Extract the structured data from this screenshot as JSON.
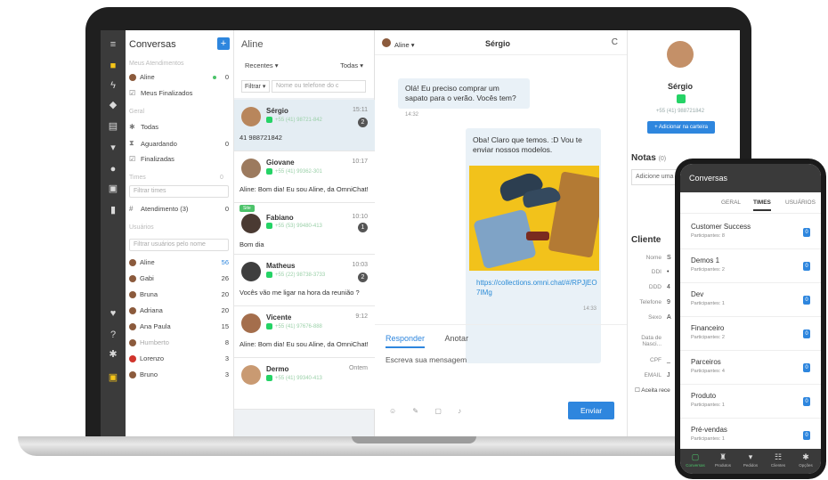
{
  "rail": {
    "icons": [
      "menu-icon",
      "chat-icon",
      "bolt-icon",
      "tag-icon",
      "list-icon",
      "cart-icon",
      "user-icon",
      "contacts-icon",
      "chart-icon",
      "heart-icon",
      "help-icon",
      "gear-icon",
      "info-icon"
    ]
  },
  "sidebar": {
    "title": "Conversas",
    "add": "+",
    "section_meus": "Meus Atendimentos",
    "meus": [
      {
        "label": "Aline",
        "count": "0"
      },
      {
        "label": "Meus Finalizados",
        "count": ""
      }
    ],
    "section_geral": "Geral",
    "geral": [
      {
        "label": "Todas",
        "count": ""
      },
      {
        "label": "Aguardando",
        "count": "0"
      },
      {
        "label": "Finalizadas",
        "count": ""
      }
    ],
    "section_times": "Times",
    "times_count": "0",
    "times_filter": "Filtrar times",
    "times": [
      {
        "label": "Atendimento (3)",
        "count": "0"
      }
    ],
    "section_usuarios": "Usuários",
    "users_filter": "Filtrar usuários pelo nome",
    "users": [
      {
        "label": "Aline",
        "count": "56"
      },
      {
        "label": "Gabi",
        "count": "26"
      },
      {
        "label": "Bruna",
        "count": "20"
      },
      {
        "label": "Adriana",
        "count": "20"
      },
      {
        "label": "Ana Paula",
        "count": "15"
      },
      {
        "label": "Humberto",
        "count": "8"
      },
      {
        "label": "Lorenzo",
        "count": "3"
      },
      {
        "label": "Bruno",
        "count": "3"
      }
    ]
  },
  "chats": {
    "title": "Aline",
    "recentes": "Recentes ▾",
    "todas": "Todas ▾",
    "filtrar": "Filtrar ▾",
    "search_placeholder": "Nome ou telefone do c",
    "items": [
      {
        "name": "Sérgio",
        "phone": "+55 (41) 98721-842",
        "time": "15:11",
        "badge": "2",
        "preview": "41 988721842",
        "tag": ""
      },
      {
        "name": "Giovane",
        "phone": "+55 (41) 99362-301",
        "time": "10:17",
        "badge": "",
        "preview": "Aline: Bom dia! Eu sou Aline, da OmniChat!",
        "tag": ""
      },
      {
        "name": "Fabiano",
        "phone": "+55 (53) 99480-413",
        "time": "10:10",
        "badge": "1",
        "preview": "Bom dia",
        "tag": "Site"
      },
      {
        "name": "Matheus",
        "phone": "+55 (22) 98738-3733",
        "time": "10:03",
        "badge": "2",
        "preview": "Vocês vão me ligar na hora da reunião ?",
        "tag": ""
      },
      {
        "name": "Vicente",
        "phone": "+55 (41) 97676-888",
        "time": "9:12",
        "badge": "",
        "preview": "Aline: Bom dia! Eu sou Aline, da OmniChat!",
        "tag": ""
      },
      {
        "name": "Dermo",
        "phone": "+55 (41) 99340-413",
        "time": "Ontem",
        "badge": "",
        "preview": "",
        "tag": ""
      }
    ]
  },
  "conversation": {
    "agent": "Aline ▾",
    "contact": "Sérgio",
    "refresh": "C",
    "msg1": "Olá! Eu preciso comprar um sapato para o verão. Vocês tem?",
    "msg1_time": "14:32",
    "msg2": "Oba! Claro que temos. :D Vou te enviar nossos modelos.",
    "link": "https://collections.omni.chat/#/RPJjEO7IMg",
    "msg2_time": "14:33",
    "tab_reply": "Responder",
    "tab_note": "Anotar",
    "placeholder": "Escreva sua mensagem",
    "tools": "☺ ✎ ▢ ♪",
    "send": "Enviar"
  },
  "contact_panel": {
    "name": "Sérgio",
    "phone": "+55 (41) 988721842",
    "add_portfolio": "+ Adicionar na carteira",
    "notes_title": "Notas",
    "notes_count": "(0)",
    "notes_add": "Adicione uma",
    "client_title": "Cliente",
    "fields": [
      {
        "label": "Nome",
        "value": "S"
      },
      {
        "label": "DDI",
        "value": "•"
      },
      {
        "label": "DDD",
        "value": "4"
      },
      {
        "label": "Telefone",
        "value": "9"
      },
      {
        "label": "Sexo",
        "value": "A"
      },
      {
        "label": "Data de Nasci...",
        "value": ""
      },
      {
        "label": "CPF",
        "value": "_"
      },
      {
        "label": "EMAIL",
        "value": "J"
      }
    ],
    "accept": "Aceita rece"
  },
  "phone": {
    "title": "Conversas",
    "tabs": [
      "GERAL",
      "TIMES",
      "USUÁRIOS"
    ],
    "active_tab": "TIMES",
    "teams": [
      {
        "name": "Customer Success",
        "participants": "Participantes: 8",
        "badge": "0"
      },
      {
        "name": "Demos 1",
        "participants": "Participantes: 2",
        "badge": "0"
      },
      {
        "name": "Dev",
        "participants": "Participantes: 1",
        "badge": "0"
      },
      {
        "name": "Financeiro",
        "participants": "Participantes: 2",
        "badge": "0"
      },
      {
        "name": "Parceiros",
        "participants": "Participantes: 4",
        "badge": "0"
      },
      {
        "name": "Produto",
        "participants": "Participantes: 1",
        "badge": "0"
      },
      {
        "name": "Pré-vendas",
        "participants": "Participantes: 1",
        "badge": "0"
      }
    ],
    "nav": [
      {
        "icon": "chat-icon",
        "label": "Conversas"
      },
      {
        "icon": "product-icon",
        "label": "Produtos"
      },
      {
        "icon": "cart-icon",
        "label": "Pedidos"
      },
      {
        "icon": "clients-icon",
        "label": "Clientes"
      },
      {
        "icon": "gear-icon",
        "label": "Opções"
      }
    ]
  }
}
